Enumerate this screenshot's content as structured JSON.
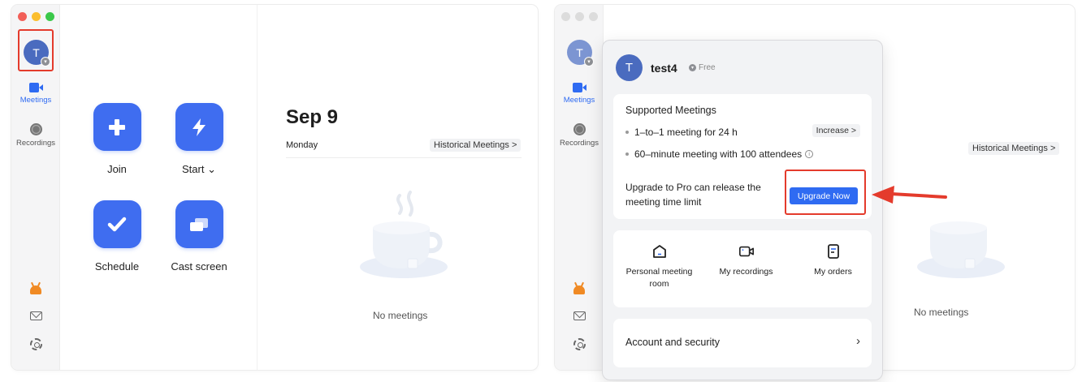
{
  "left_window": {
    "avatar_initial": "T",
    "nav": {
      "meetings": "Meetings",
      "recordings": "Recordings"
    },
    "actions": {
      "join": "Join",
      "start": "Start ⌄",
      "schedule": "Schedule",
      "cast": "Cast screen"
    },
    "date": "Sep 9",
    "weekday": "Monday",
    "historical": "Historical Meetings >",
    "empty": "No meetings"
  },
  "right_window": {
    "avatar_initial": "T",
    "nav": {
      "meetings": "Meetings",
      "recordings": "Recordings"
    },
    "historical": "Historical Meetings >",
    "empty": "No meetings"
  },
  "popup": {
    "avatar_initial": "T",
    "username": "test4",
    "plan": "Free",
    "supported_title": "Supported Meetings",
    "bullet_1": "1–to–1 meeting for 24 h",
    "bullet_2": "60–minute meeting with 100 attendees",
    "increase_label": "Increase >",
    "upgrade_text": "Upgrade to Pro can release the meeting time limit",
    "upgrade_button": "Upgrade Now",
    "shortcuts": {
      "personal_room": "Personal meeting room",
      "my_recordings": "My recordings",
      "my_orders": "My orders"
    },
    "account_security": "Account and security"
  },
  "colors": {
    "accent": "#2f6bf2",
    "tile": "#3f6df0",
    "highlight": "#e43b2c"
  }
}
